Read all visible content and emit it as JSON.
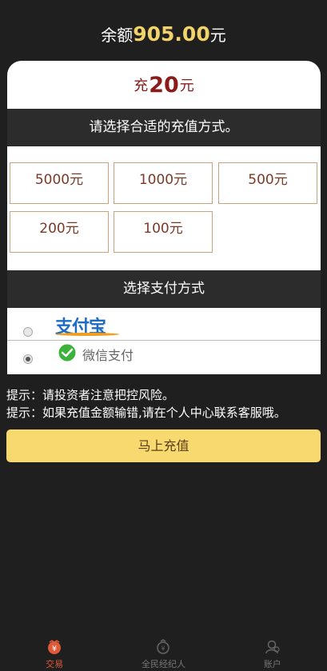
{
  "balance": {
    "prefix": "余额",
    "amount": "905.00",
    "suffix": "元"
  },
  "charge": {
    "prefix": "充",
    "amount": "20",
    "suffix": "元"
  },
  "section_amount_title": "请选择合适的充值方式。",
  "amounts": [
    "5000元",
    "1000元",
    "500元",
    "200元",
    "100元"
  ],
  "section_pay_title": "选择支付方式",
  "payment_methods": [
    {
      "id": "alipay",
      "label": "支付宝",
      "checked": false
    },
    {
      "id": "wechat",
      "label": "微信支付",
      "checked": true
    }
  ],
  "tips": [
    "提示：请投资者注意把控风险。",
    "提示：如果充值金额输错,请在个人中心联系客服哦。"
  ],
  "submit_label": "马上充值",
  "tabs": [
    {
      "label": "交易",
      "icon": "trade-icon",
      "active": true
    },
    {
      "label": "全民经纪人",
      "icon": "broker-icon",
      "active": false
    },
    {
      "label": "账户",
      "icon": "account-icon",
      "active": false
    }
  ],
  "colors": {
    "accent": "#f8d970",
    "balance": "#f1d36a",
    "charge": "#8b1a1a",
    "tab_active": "#e05a3a"
  }
}
